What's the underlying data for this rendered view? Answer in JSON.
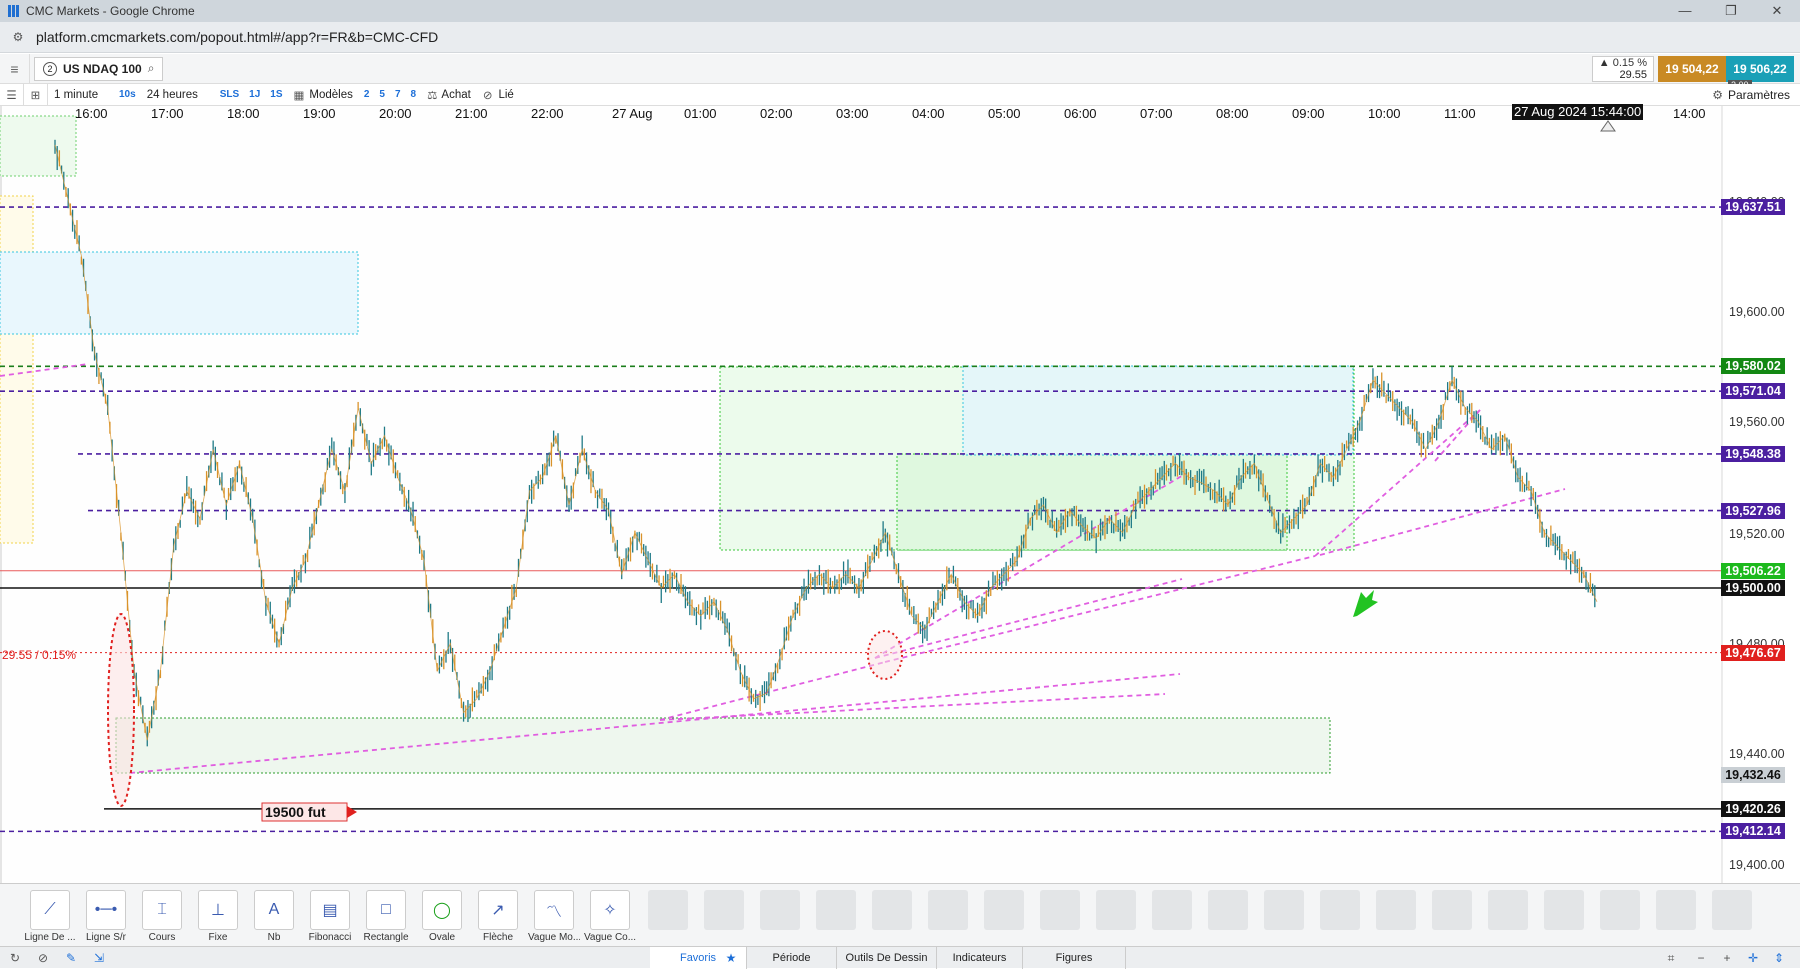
{
  "window": {
    "title": "CMC Markets - Google Chrome",
    "url": "platform.cmcmarkets.com/popout.html#/app?r=FR&b=CMC-CFD"
  },
  "instrument": {
    "number": "2",
    "name": "US NDAQ 100"
  },
  "quote": {
    "change_pct": "▲ 0.15 %",
    "change_pts": "29.55",
    "sell": "19 504,22",
    "buy": "19 506,22",
    "spread": "2.00"
  },
  "toolbar": {
    "interval": "1 minute",
    "sec10": "10s",
    "period": "24 heures",
    "sls": "SLS",
    "oneJ": "1J",
    "oneS": "1S",
    "models": "Modèles",
    "n2": "2",
    "n5": "5",
    "n7": "7",
    "n8": "8",
    "buy": "Achat",
    "linked": "Lié",
    "settings": "Paramètres"
  },
  "time_axis": {
    "labels": [
      "16:00",
      "17:00",
      "18:00",
      "19:00",
      "20:00",
      "21:00",
      "22:00",
      "27 Aug",
      "01:00",
      "02:00",
      "03:00",
      "04:00",
      "05:00",
      "06:00",
      "07:00",
      "08:00",
      "09:00",
      "10:00",
      "11:00",
      "14:00"
    ],
    "cursor": "27 Aug 2024 15:44:00"
  },
  "price_axis": {
    "ticks": [
      "19,600.00",
      "19,560.00",
      "19,520.00",
      "19,440.00",
      "19,400.00"
    ],
    "partial_ticks": [
      "19,640.00",
      "19,480.00"
    ],
    "levels": [
      {
        "label": "19,637.51",
        "price": 19637.51,
        "kind": "purple"
      },
      {
        "label": "19,580.02",
        "price": 19580.02,
        "kind": "green"
      },
      {
        "label": "19,571.04",
        "price": 19571.04,
        "kind": "purple"
      },
      {
        "label": "19,548.38",
        "price": 19548.38,
        "kind": "purple"
      },
      {
        "label": "19,527.96",
        "price": 19527.96,
        "kind": "purple"
      },
      {
        "label": "19,506.22",
        "price": 19506.22,
        "kind": "current"
      },
      {
        "label": "19,500.00",
        "price": 19500.0,
        "kind": "black"
      },
      {
        "label": "19,476.67",
        "price": 19476.67,
        "kind": "red"
      },
      {
        "label": "19,432.46",
        "price": 19432.46,
        "kind": "grey"
      },
      {
        "label": "19,420.26",
        "price": 19420.26,
        "kind": "black"
      },
      {
        "label": "19,412.14",
        "price": 19412.14,
        "kind": "purple"
      }
    ]
  },
  "chart_data": {
    "type": "line",
    "title": "",
    "xlabel": "",
    "ylabel": "",
    "ylim": [
      19392,
      19666
    ],
    "interval": "1 minute",
    "x_range": [
      "26 Aug 15:45",
      "27 Aug 15:44"
    ],
    "annotations": {
      "change_text": "29.55 / 0.15%",
      "fut_label": "19500 fut"
    },
    "series": [
      {
        "values": [
          19660,
          19640,
          19620,
          19585,
          19565,
          19520,
          19470,
          19445,
          19470,
          19515,
          19535,
          19525,
          19550,
          19530,
          19545,
          19525,
          19495,
          19480,
          19500,
          19510,
          19530,
          19550,
          19535,
          19565,
          19545,
          19555,
          19540,
          19528,
          19510,
          19470,
          19480,
          19455,
          19460,
          19470,
          19485,
          19500,
          19535,
          19540,
          19555,
          19530,
          19550,
          19535,
          19528,
          19505,
          19520,
          19510,
          19500,
          19505,
          19495,
          19490,
          19495,
          19485,
          19470,
          19460,
          19462,
          19475,
          19490,
          19500,
          19505,
          19500,
          19505,
          19500,
          19510,
          19520,
          19505,
          19490,
          19485,
          19495,
          19505,
          19495,
          19490,
          19500,
          19505,
          19510,
          19525,
          19530,
          19520,
          19528,
          19522,
          19518,
          19525,
          19520,
          19530,
          19535,
          19540,
          19545,
          19540,
          19538,
          19535,
          19530,
          19540,
          19545,
          19532,
          19520,
          19525,
          19530,
          19545,
          19540,
          19550,
          19560,
          19575,
          19570,
          19565,
          19560,
          19550,
          19560,
          19575,
          19565,
          19560,
          19550,
          19555,
          19540,
          19535,
          19520,
          19515,
          19510,
          19505,
          19495
        ]
      }
    ]
  },
  "bottom_tools": [
    "Ligne De ...",
    "Ligne S/r",
    "Cours",
    "Fixe",
    "Nb",
    "Fibonacci",
    "Rectangle",
    "Ovale",
    "Flèche",
    "Vague Mo...",
    "Vague Co..."
  ],
  "bottom_tabs": {
    "favorites": "Favoris",
    "period": "Période",
    "drawing": "Outils De Dessin",
    "indicators": "Indicateurs",
    "figures": "Figures"
  },
  "colors": {
    "up_candle": "#1f7a86",
    "down_candle": "#d9932b",
    "purple_line": "#4b1fa0",
    "green_line": "#1b7d1b",
    "current_price": "#1db91d",
    "red_level": "#e0201e",
    "magenta_trend": "#e05ee0"
  }
}
